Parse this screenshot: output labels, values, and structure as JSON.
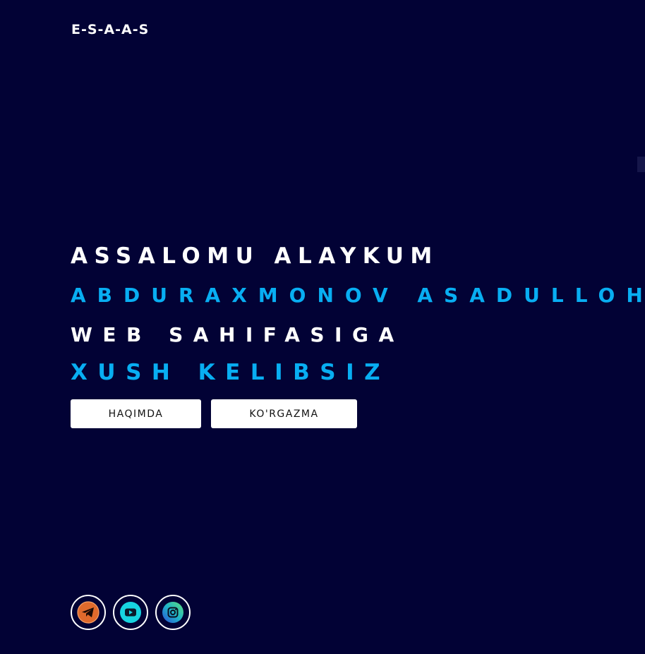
{
  "header": {
    "logo": "E-S-A-A-S"
  },
  "hero": {
    "line1": "ASSALOMU ALAYKUM",
    "line2": "ABDURAXMONOV ASADULLOH",
    "line3": "WEB SAHIFASIGA",
    "line4": "XUSH KELIBSIZ"
  },
  "buttons": {
    "about": "HAQIMDA",
    "exhibit": "KO'RGAZMA"
  },
  "social": [
    {
      "icon": "telegram-icon",
      "color": "#e8672a"
    },
    {
      "icon": "youtube-icon",
      "color": "#17d4e0"
    },
    {
      "icon": "instagram-icon",
      "color": "#2cc6a0"
    }
  ],
  "colors": {
    "background": "#020235",
    "accent": "#08aef2",
    "text": "#ffffff"
  }
}
